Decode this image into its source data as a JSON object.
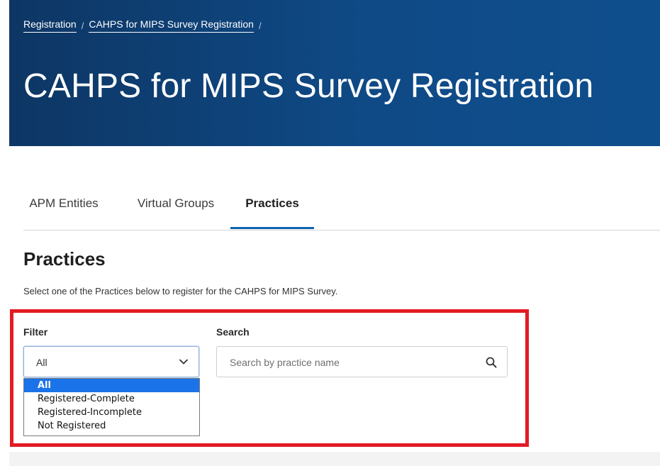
{
  "breadcrumb": [
    {
      "label": "Registration"
    },
    {
      "label": "CAHPS for MIPS Survey Registration"
    }
  ],
  "breadcrumb_sep": "/",
  "page_title": "CAHPS for MIPS Survey Registration",
  "tabs": [
    {
      "label": "APM Entities"
    },
    {
      "label": "Virtual Groups"
    },
    {
      "label": "Practices",
      "active": true
    }
  ],
  "section": {
    "title": "Practices",
    "description": "Select one of the Practices below to register for the CAHPS for MIPS Survey."
  },
  "filter": {
    "label": "Filter",
    "selected": "All",
    "options": [
      "All",
      "Registered-Complete",
      "Registered-Incomplete",
      "Not Registered"
    ]
  },
  "search": {
    "label": "Search",
    "placeholder": "Search by practice name",
    "value": ""
  },
  "colors": {
    "hero": "#0f4a86",
    "tab_active": "#0f63b0",
    "highlight_border": "#e31b23",
    "option_selected": "#1a73e8"
  },
  "icons": {
    "filter_dropdown": "chevron-down-icon",
    "search": "search-icon"
  }
}
